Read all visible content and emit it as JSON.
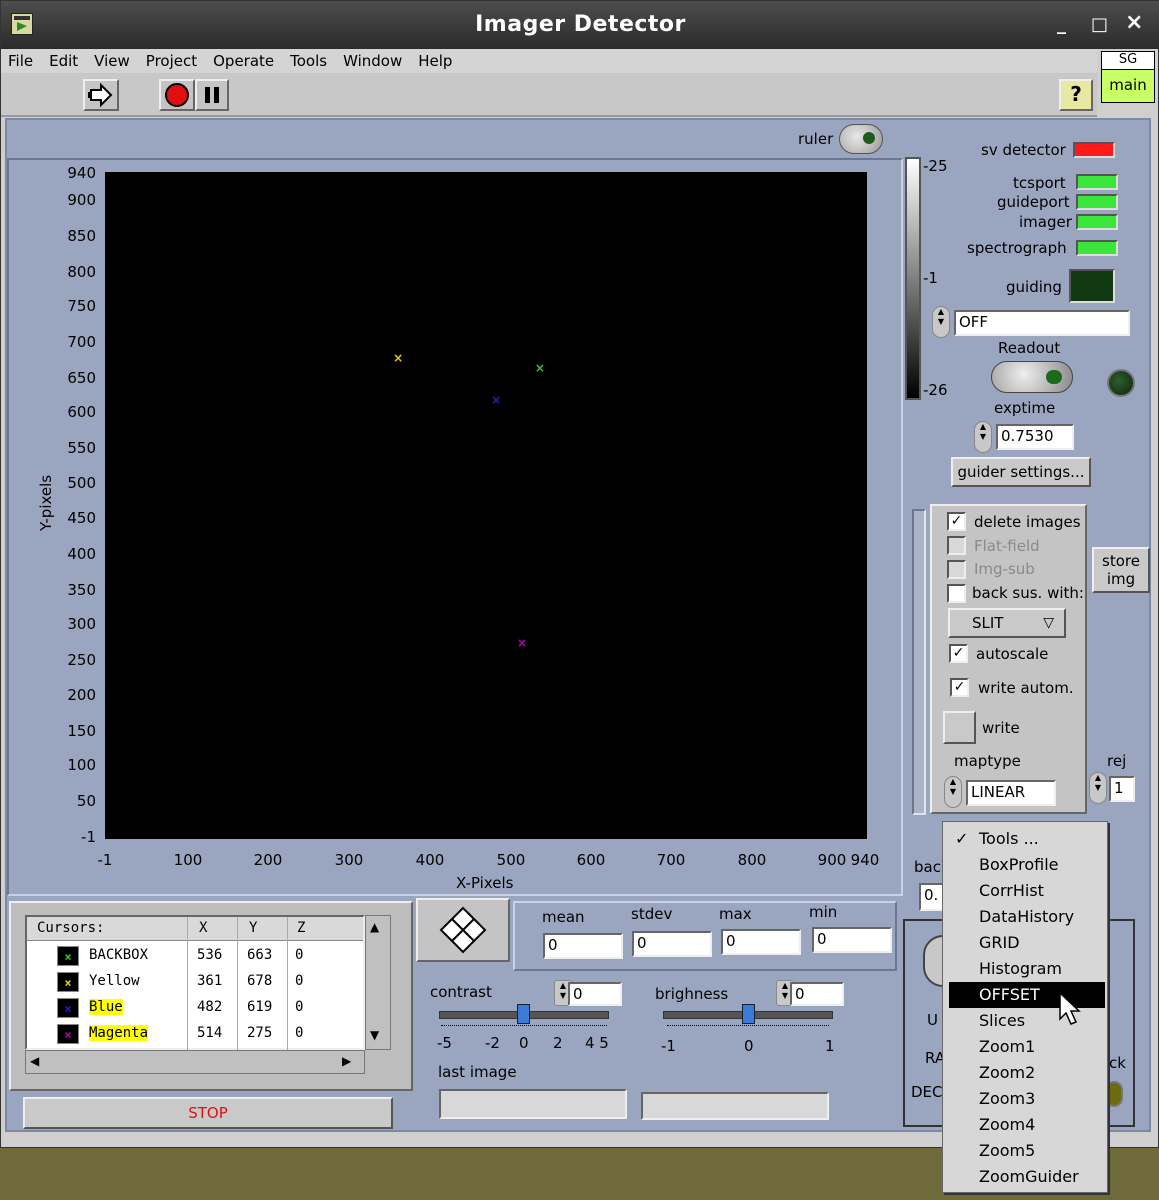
{
  "window": {
    "title": "Imager Detector",
    "minimize": "_",
    "maximize": "□",
    "close": "×"
  },
  "menu": [
    "File",
    "Edit",
    "View",
    "Project",
    "Operate",
    "Tools",
    "Window",
    "Help"
  ],
  "toolbar": {
    "help": "?"
  },
  "sg": {
    "top": "SG",
    "bottom": "main"
  },
  "ruler": {
    "label": "ruler"
  },
  "plot": {
    "xlabel": "X-Pixels",
    "ylabel": "Y-pixels",
    "yticks": [
      "940",
      "900",
      "850",
      "800",
      "750",
      "700",
      "650",
      "600",
      "550",
      "500",
      "450",
      "400",
      "350",
      "300",
      "250",
      "200",
      "150",
      "100",
      "50",
      "-1"
    ],
    "xticks": [
      "-1",
      "100",
      "200",
      "300",
      "400",
      "500",
      "600",
      "700",
      "800",
      "900",
      "940"
    ]
  },
  "markers": [
    {
      "name": "BACKBOX",
      "x": 536,
      "y": 663,
      "color": "#32c832"
    },
    {
      "name": "Yellow",
      "x": 361,
      "y": 678,
      "color": "#e6d200"
    },
    {
      "name": "Blue",
      "x": 482,
      "y": 619,
      "color": "#2020d0"
    },
    {
      "name": "Magenta",
      "x": 514,
      "y": 275,
      "color": "#b000b0"
    }
  ],
  "colorbar": {
    "top": "-25",
    "mid": "-1",
    "bottom": "-26"
  },
  "status": {
    "sv_detector": "sv detector",
    "tcsport": "tcsport",
    "guideport": "guideport",
    "imager": "imager",
    "spectrograph": "spectrograph",
    "guiding": "guiding",
    "mode_value": "OFF",
    "readout": "Readout",
    "exptime_label": "exptime",
    "exptime_value": "0.7530",
    "guider_settings": "guider settings..."
  },
  "options": {
    "delete_images": "delete images",
    "flat_field": "Flat-field",
    "img_sub": "Img-sub",
    "back_sus": "back sus. with:",
    "slit": "SLIT",
    "autoscale": "autoscale",
    "write_autom": "write autom.",
    "write": "write",
    "maptype_label": "maptype",
    "maptype_value": "LINEAR",
    "rej_label": "rej",
    "rej_value": "1",
    "store_img": "store img"
  },
  "cursors": {
    "header": [
      "Cursors:",
      "X",
      "Y",
      "Z"
    ],
    "rows": [
      {
        "name": "BACKBOX",
        "x": "536",
        "y": "663",
        "z": "0",
        "mark": "×",
        "highlight": false
      },
      {
        "name": "Yellow",
        "x": "361",
        "y": "678",
        "z": "0",
        "mark": "×",
        "highlight": false
      },
      {
        "name": "Blue",
        "x": "482",
        "y": "619",
        "z": "0",
        "mark": "×",
        "highlight": true
      },
      {
        "name": "Magenta",
        "x": "514",
        "y": "275",
        "z": "0",
        "mark": "×",
        "highlight": true
      }
    ],
    "stop": "STOP"
  },
  "stats": {
    "mean_label": "mean",
    "mean": "0",
    "stdev_label": "stdev",
    "stdev": "0",
    "max_label": "max",
    "max": "0",
    "min_label": "min",
    "min": "0"
  },
  "contrast": {
    "label": "contrast",
    "value": "0",
    "ticks": [
      "-5",
      "-2",
      "0",
      "2",
      "4 5"
    ]
  },
  "brighness": {
    "label": "brighness",
    "value": "0",
    "ticks": [
      "-1",
      "0",
      "1"
    ]
  },
  "last_image": {
    "label": "last image"
  },
  "hidden_labels": {
    "back": "bacl",
    "back_val": "0.",
    "ut": "U",
    "ra": "RA",
    "dec": "DEC",
    "ack": "ck"
  },
  "tools_menu": {
    "items": [
      "Tools ...",
      "BoxProfile",
      "CorrHist",
      "DataHistory",
      "GRID",
      "Histogram",
      "OFFSET",
      "Slices",
      "Zoom1",
      "Zoom2",
      "Zoom3",
      "Zoom4",
      "Zoom5",
      "ZoomGuider"
    ],
    "checked": "✓",
    "selected": "OFFSET"
  }
}
